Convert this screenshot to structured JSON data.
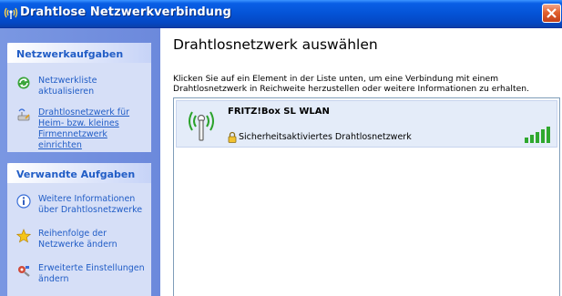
{
  "window": {
    "title": "Drahtlose Netzwerkverbindung"
  },
  "taskpane": {
    "network_tasks": {
      "header": "Netzwerkaufgaben",
      "items": [
        {
          "label": "Netzwerkliste aktualisieren",
          "icon": "refresh-icon"
        },
        {
          "label": "Drahtlosnetzwerk für Heim- bzw. kleines Firmennetzwerk einrichten",
          "icon": "setup-wizard-icon"
        }
      ]
    },
    "related_tasks": {
      "header": "Verwandte Aufgaben",
      "items": [
        {
          "label": "Weitere Informationen über Drahtlosnetzwerke",
          "icon": "info-icon"
        },
        {
          "label": "Reihenfolge der Netzwerke ändern",
          "icon": "star-icon"
        },
        {
          "label": "Erweiterte Einstellungen ändern",
          "icon": "settings-icon"
        }
      ]
    }
  },
  "main": {
    "heading": "Drahtlosnetzwerk auswählen",
    "instructions": "Klicken Sie auf ein Element in der Liste unten, um eine Verbindung mit einem Drahtlosnetzwerk in Reichweite herzustellen oder weitere Informationen zu erhalten.",
    "networks": [
      {
        "ssid": "FRITZ!Box SL WLAN",
        "security": "Sicherheitsaktiviertes Drahtlosnetzwerk",
        "signal_bars": 5,
        "signal_max": 5
      }
    ]
  },
  "colors": {
    "titlebar": "#0453d6",
    "taskpane": "#6c89dc",
    "link": "#215dc6",
    "close": "#e2622f",
    "signal": "#2fa82f"
  }
}
